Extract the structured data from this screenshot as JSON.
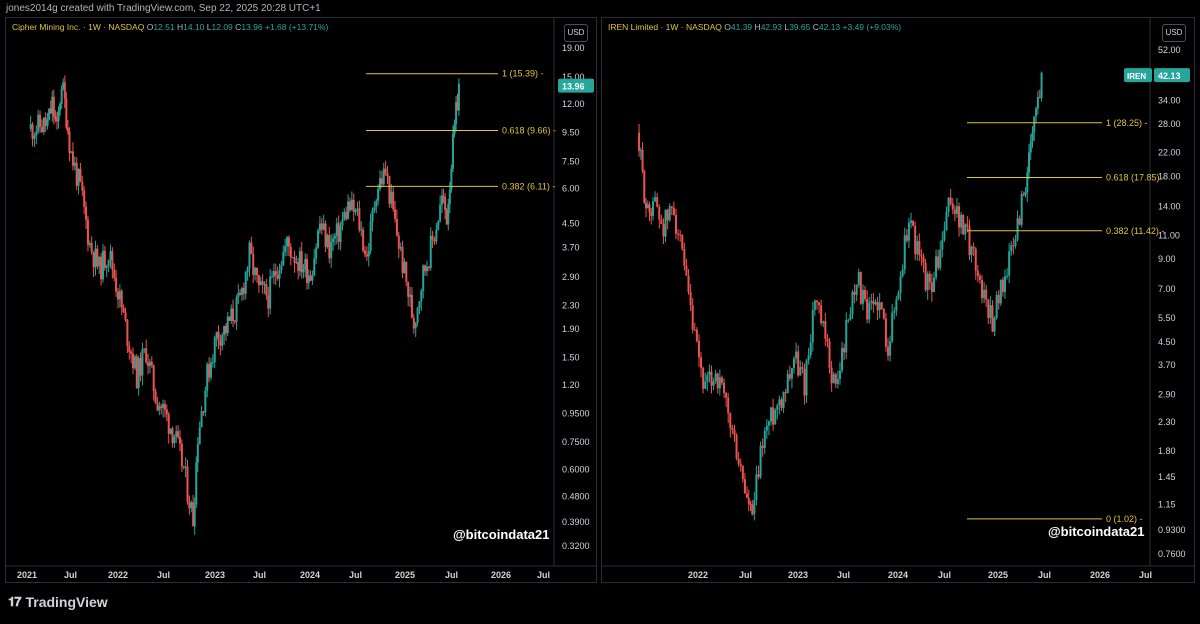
{
  "credit": "jones2014g created with TradingView.com, Sep 22, 2025 20:28 UTC+1",
  "brand": "TradingView",
  "colors": {
    "up": "#26a69a",
    "down": "#ef5350",
    "fib": "#e0c341",
    "grid": "#1a1d25",
    "axis_text": "#d1d4dc"
  },
  "chart_data": [
    {
      "type": "candlestick",
      "legend": {
        "name": "Cipher Mining Inc.",
        "interval": "1W",
        "exchange": "NASDAQ",
        "open": "12.51",
        "high": "14.10",
        "low": "12.09",
        "close": "13.96",
        "change": "+1.68 (+13.71%)"
      },
      "currency": "USD",
      "scale": "log",
      "y_ticks": [
        "19.00",
        "15.00",
        "12.00",
        "9.50",
        "7.50",
        "6.00",
        "4.50",
        "3.70",
        "2.90",
        "2.30",
        "1.90",
        "1.50",
        "1.20",
        "0.9500",
        "0.7500",
        "0.6000",
        "0.4800",
        "0.3900",
        "0.3200"
      ],
      "x_ticks": [
        "2021",
        "Jul",
        "2022",
        "Jul",
        "2023",
        "Jul",
        "2024",
        "Jul",
        "2025",
        "Jul",
        "2026",
        "Jul"
      ],
      "last_price": "13.96",
      "fib_levels": [
        {
          "label": "1 (15.39)",
          "value": 15.39
        },
        {
          "label": "0.618 (9.66)",
          "value": 9.66
        },
        {
          "label": "0.382 (6.11)",
          "value": 6.11
        }
      ],
      "price_path": [
        [
          2021.2,
          9.8
        ],
        [
          2021.4,
          10.2
        ],
        [
          2021.45,
          12
        ],
        [
          2021.5,
          9.6
        ],
        [
          2021.55,
          14.5
        ],
        [
          2021.6,
          11
        ],
        [
          2021.65,
          8
        ],
        [
          2021.75,
          6
        ],
        [
          2021.85,
          3.8
        ],
        [
          2021.95,
          3.1
        ],
        [
          2022.05,
          3.6
        ],
        [
          2022.15,
          2.6
        ],
        [
          2022.25,
          1.8
        ],
        [
          2022.35,
          1.3
        ],
        [
          2022.45,
          1.6
        ],
        [
          2022.55,
          1.1
        ],
        [
          2022.65,
          0.95
        ],
        [
          2022.75,
          0.8
        ],
        [
          2022.85,
          0.6
        ],
        [
          2022.95,
          0.4
        ],
        [
          2023.0,
          0.8
        ],
        [
          2023.1,
          1.3
        ],
        [
          2023.2,
          1.8
        ],
        [
          2023.3,
          1.9
        ],
        [
          2023.45,
          2.4
        ],
        [
          2023.55,
          3.5
        ],
        [
          2023.65,
          2.6
        ],
        [
          2023.75,
          2.5
        ],
        [
          2023.85,
          3.2
        ],
        [
          2023.95,
          3.8
        ],
        [
          2024.05,
          3.4
        ],
        [
          2024.2,
          3.0
        ],
        [
          2024.3,
          4.5
        ],
        [
          2024.4,
          3.7
        ],
        [
          2024.5,
          4.2
        ],
        [
          2024.6,
          5.2
        ],
        [
          2024.7,
          4.8
        ],
        [
          2024.8,
          3.4
        ],
        [
          2024.9,
          6.0
        ],
        [
          2025.0,
          6.9
        ],
        [
          2025.1,
          4.5
        ],
        [
          2025.2,
          3.0
        ],
        [
          2025.3,
          2.0
        ],
        [
          2025.4,
          3.0
        ],
        [
          2025.5,
          3.9
        ],
        [
          2025.6,
          5.5
        ],
        [
          2025.65,
          4.8
        ],
        [
          2025.7,
          7.5
        ],
        [
          2025.75,
          11
        ],
        [
          2025.78,
          13.96
        ]
      ],
      "watermark": "@bitcoindata21"
    },
    {
      "type": "candlestick",
      "legend": {
        "name": "IREN Limited",
        "interval": "1W",
        "exchange": "NASDAQ",
        "open": "41.39",
        "high": "42.93",
        "low": "39.65",
        "close": "42.13",
        "change": "+3.49 (+9.03%)"
      },
      "currency": "USD",
      "scale": "log",
      "y_ticks": [
        "52.00",
        "42.00",
        "34.00",
        "28.00",
        "22.00",
        "18.00",
        "14.00",
        "11.00",
        "9.00",
        "7.00",
        "5.50",
        "4.50",
        "3.70",
        "2.90",
        "2.30",
        "1.80",
        "1.45",
        "1.15",
        "0.9300",
        "0.7600"
      ],
      "x_ticks": [
        "2022",
        "Jul",
        "2023",
        "Jul",
        "2024",
        "Jul",
        "2025",
        "Jul",
        "2026",
        "Jul"
      ],
      "last_price": "42.13",
      "symbol_badge": "IREN",
      "fib_levels": [
        {
          "label": "1 (28.25)",
          "value": 28.25
        },
        {
          "label": "0.618 (17.85)",
          "value": 17.85
        },
        {
          "label": "0.382 (11.42)",
          "value": 11.42
        },
        {
          "label": "0 (1.02)",
          "value": 1.02
        }
      ],
      "price_path": [
        [
          2021.85,
          26
        ],
        [
          2021.9,
          18
        ],
        [
          2021.95,
          13
        ],
        [
          2022.0,
          15
        ],
        [
          2022.1,
          12
        ],
        [
          2022.2,
          14
        ],
        [
          2022.3,
          8
        ],
        [
          2022.4,
          4.5
        ],
        [
          2022.5,
          3.0
        ],
        [
          2022.6,
          3.5
        ],
        [
          2022.7,
          2.6
        ],
        [
          2022.8,
          1.8
        ],
        [
          2022.9,
          1.2
        ],
        [
          2022.95,
          1.02
        ],
        [
          2023.05,
          2.0
        ],
        [
          2023.15,
          2.5
        ],
        [
          2023.25,
          3.0
        ],
        [
          2023.35,
          4.0
        ],
        [
          2023.45,
          3.2
        ],
        [
          2023.55,
          6.5
        ],
        [
          2023.65,
          4.5
        ],
        [
          2023.75,
          3.0
        ],
        [
          2023.85,
          5.0
        ],
        [
          2023.95,
          8.0
        ],
        [
          2024.05,
          5.5
        ],
        [
          2024.15,
          6.5
        ],
        [
          2024.25,
          4.5
        ],
        [
          2024.35,
          7.0
        ],
        [
          2024.45,
          13.0
        ],
        [
          2024.55,
          9.0
        ],
        [
          2024.65,
          7.0
        ],
        [
          2024.75,
          9.5
        ],
        [
          2024.85,
          15.0
        ],
        [
          2024.95,
          12.0
        ],
        [
          2025.05,
          10.0
        ],
        [
          2025.15,
          7.0
        ],
        [
          2025.25,
          5.5
        ],
        [
          2025.35,
          7.5
        ],
        [
          2025.45,
          10.0
        ],
        [
          2025.55,
          16.0
        ],
        [
          2025.6,
          20.0
        ],
        [
          2025.65,
          28.0
        ],
        [
          2025.72,
          42.13
        ]
      ],
      "watermark": "@bitcoindata21"
    }
  ]
}
